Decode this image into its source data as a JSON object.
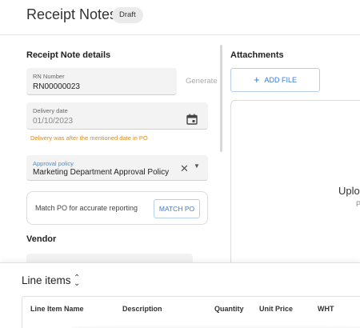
{
  "header": {
    "title": "Receipt Notes",
    "status": "Draft"
  },
  "details": {
    "section_title": "Receipt Note details",
    "rn_number": {
      "label": "RN Number",
      "value": "RN00000023"
    },
    "generate_label": "Generate",
    "delivery_date": {
      "label": "Delivery date",
      "value": "01/10/2023",
      "icon": "calendar-icon"
    },
    "warning": "Delivery was after the mentioned date in PO",
    "approval_policy": {
      "label": "Approval policy",
      "value": "Marketing Department Approval Policy"
    },
    "match_po": {
      "text": "Match PO for accurate reporting",
      "button": "MATCH PO"
    },
    "vendor_title": "Vendor"
  },
  "attachments": {
    "title": "Attachments",
    "add_file": "ADD FILE",
    "dropzone_title": "Uplo",
    "dropzone_sub": "P"
  },
  "line_items": {
    "title": "Line items",
    "columns": [
      "Line Item Name",
      "Description",
      "Quantity",
      "Unit Price",
      "WHT"
    ]
  },
  "colors": {
    "accent": "#3a7bd5",
    "warning": "#e08a1e",
    "field_bg": "#f3f3f3"
  }
}
